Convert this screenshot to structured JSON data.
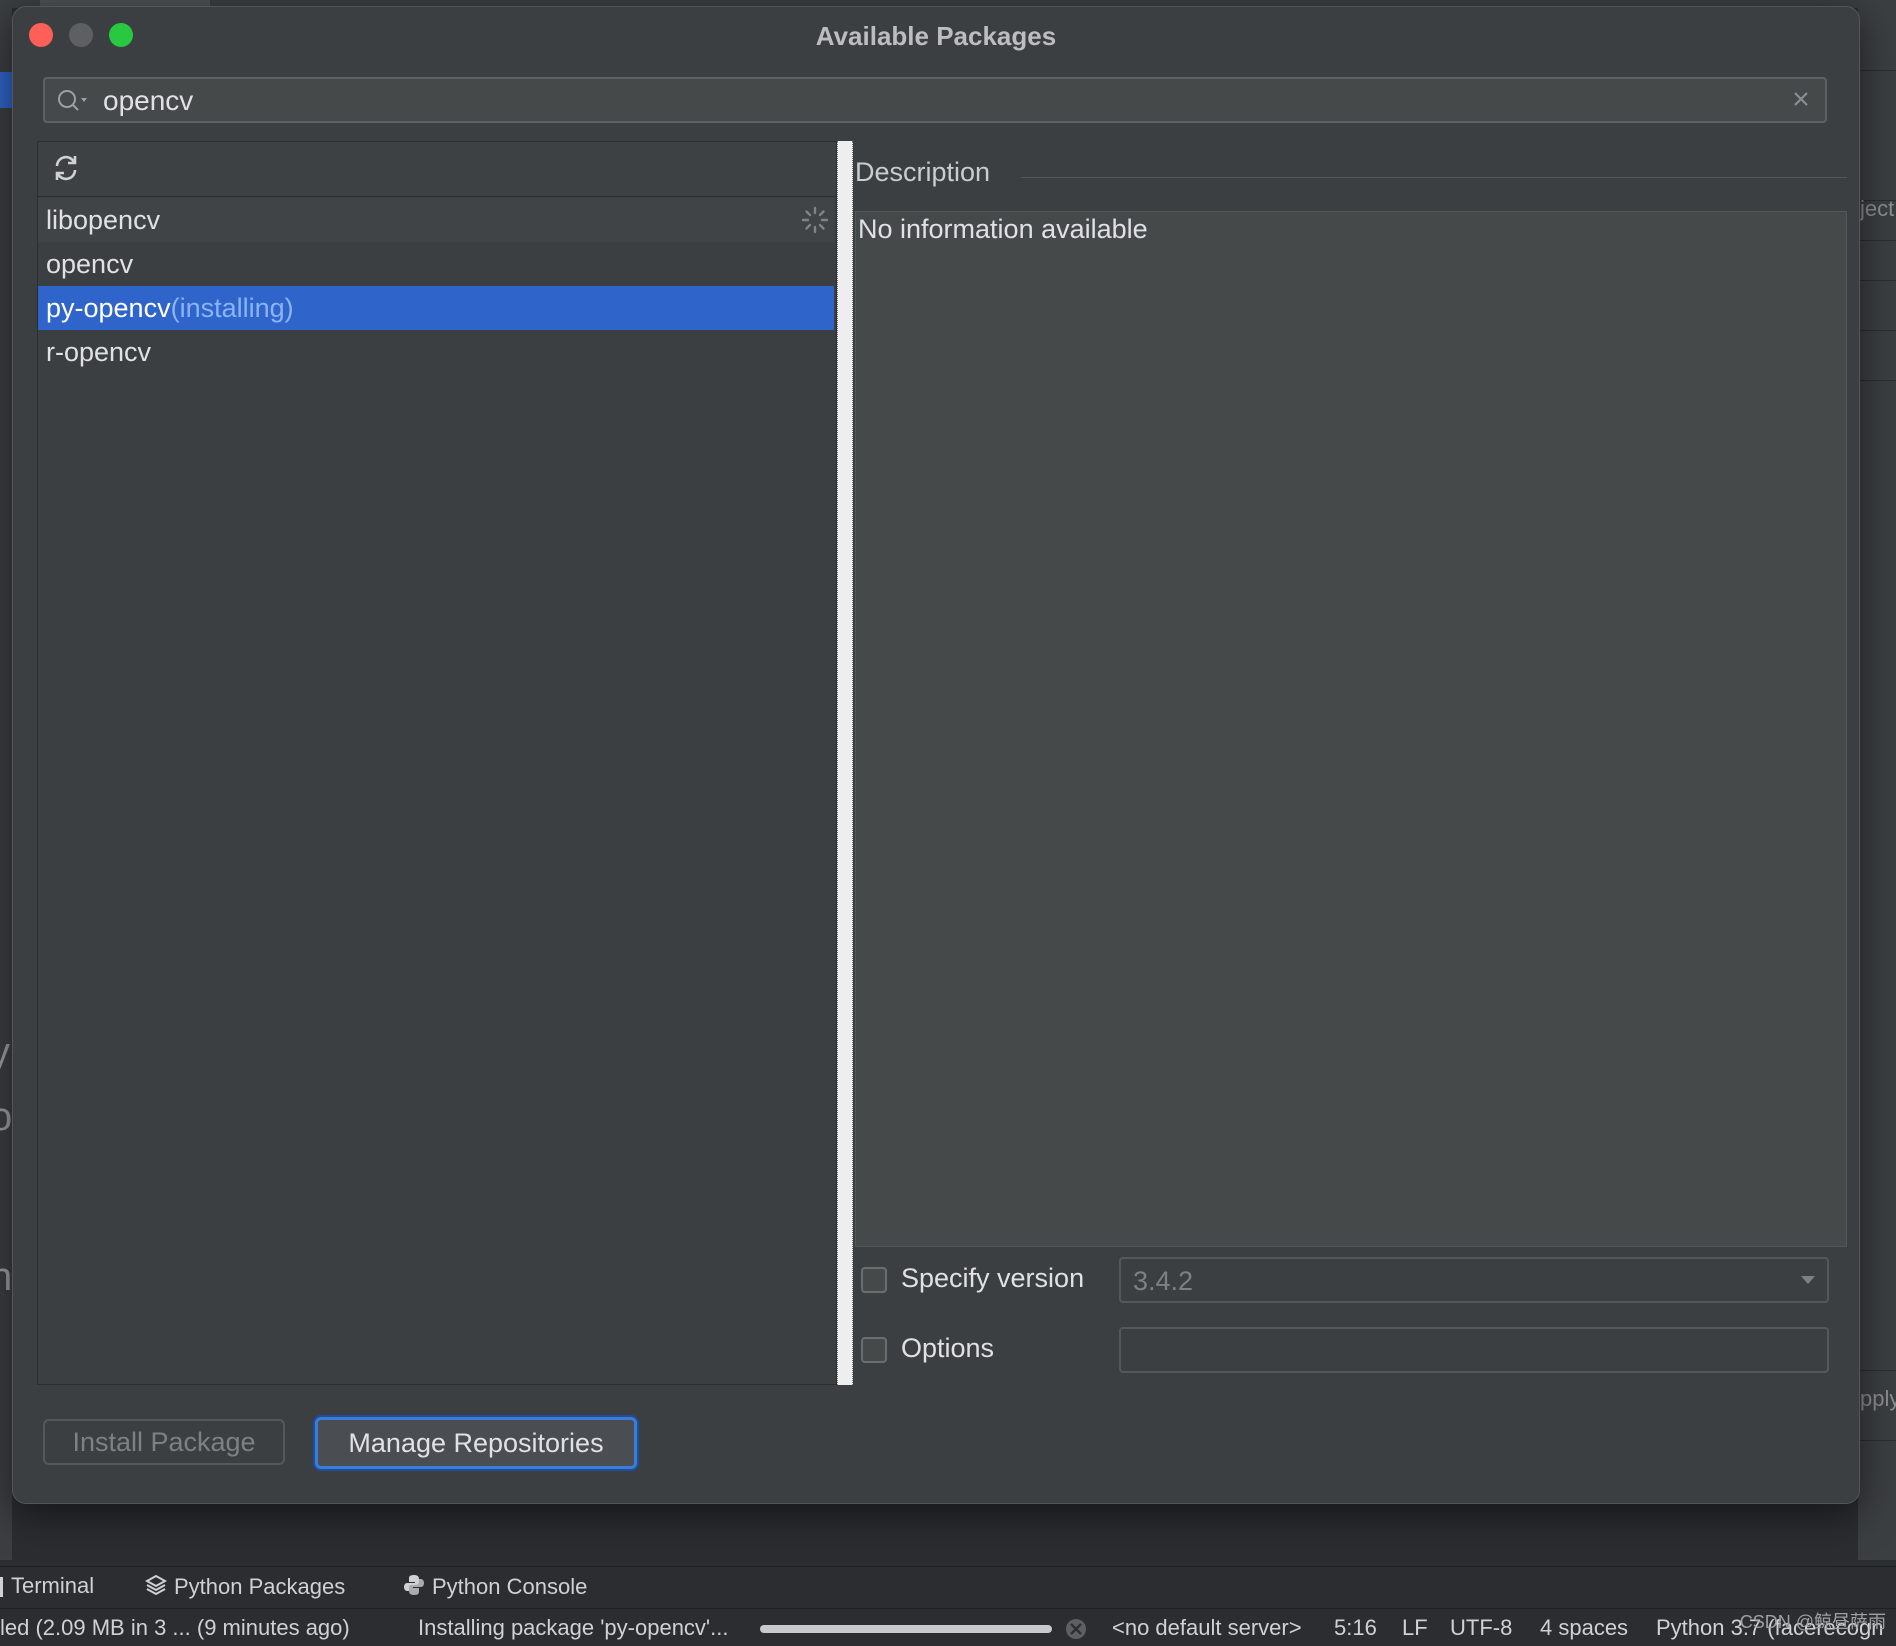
{
  "dialog": {
    "title": "Available Packages",
    "search": {
      "value": "opencv",
      "placeholder": ""
    },
    "packages": [
      {
        "name": "libopencv",
        "status": ""
      },
      {
        "name": "opencv",
        "status": ""
      },
      {
        "name": "py-opencv",
        "status": "(installing)"
      },
      {
        "name": "r-opencv",
        "status": ""
      }
    ],
    "selected_index": 2,
    "description_label": "Description",
    "description_text": "No information available",
    "specify_version_label": "Specify version",
    "specify_version_checked": false,
    "version_value": "3.4.2",
    "options_label": "Options",
    "options_checked": false,
    "options_value": "",
    "install_button": "Install Package",
    "manage_button": "Manage Repositories"
  },
  "tool_windows": [
    {
      "label": "Terminal",
      "icon": "terminal-icon"
    },
    {
      "label": "Python Packages",
      "icon": "layers-icon"
    },
    {
      "label": "Python Console",
      "icon": "python-icon"
    }
  ],
  "status_bar": {
    "left_message": "led (2.09 MB in 3 ... (9 minutes ago)",
    "task": "Installing package 'py-opencv'...",
    "progress": 1.0,
    "server": "<no default server>",
    "position": "5:16",
    "line_sep": "LF",
    "encoding": "UTF-8",
    "indent": "4 spaces",
    "interpreter": "Python 3.7 (facerecogn"
  },
  "background": {
    "right_side_text_1": "ject",
    "right_side_text_2": "pply",
    "left_side_text_1": "y",
    "left_side_text_2": "o",
    "left_side_text_3": "n"
  },
  "watermark": "CSDN @鲸昼萨雨",
  "colors": {
    "accent": "#2f65ca",
    "dialog_bg": "#3c3f41",
    "status_link": "#8ab4f8"
  }
}
